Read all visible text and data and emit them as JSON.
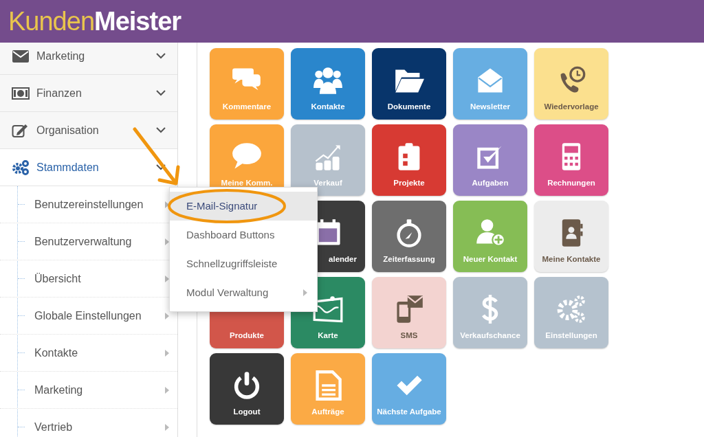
{
  "header": {
    "logo": "Kunden**Meister**"
  },
  "sidebar": {
    "items": [
      {
        "label": "Marketing",
        "kind": "envelope",
        "selected": false
      },
      {
        "label": "Finanzen",
        "kind": "money",
        "selected": false
      },
      {
        "label": "Organisation",
        "kind": "edit",
        "selected": false
      },
      {
        "label": "Stammdaten",
        "kind": "gears",
        "selected": true
      }
    ],
    "subitems": [
      {
        "label": "Benutzereinstellungen",
        "has_submenu": true
      },
      {
        "label": "Benutzerverwaltung",
        "has_submenu": true
      },
      {
        "label": "Übersicht",
        "has_submenu": true
      },
      {
        "label": "Globale Einstellungen",
        "has_submenu": true
      },
      {
        "label": "Kontakte",
        "has_submenu": true
      },
      {
        "label": "Marketing",
        "has_submenu": true
      },
      {
        "label": "Vertrieb",
        "has_submenu": true
      }
    ]
  },
  "submenu": {
    "items": [
      {
        "label": "E-Mail-Signatur",
        "selected": true,
        "has_submenu": false
      },
      {
        "label": "Dashboard Buttons",
        "selected": false,
        "has_submenu": false
      },
      {
        "label": "Schnellzugriffsleiste",
        "selected": false,
        "has_submenu": false
      },
      {
        "label": "Modul Verwaltung",
        "selected": false,
        "has_submenu": true
      }
    ]
  },
  "tiles": [
    {
      "kind": "comments",
      "label": "Kommentare",
      "color": "#fba63c"
    },
    {
      "kind": "people",
      "label": "Kontakte",
      "color": "#2a86cc"
    },
    {
      "kind": "folder",
      "label": "Dokumente",
      "color": "#08356b"
    },
    {
      "kind": "envelope",
      "label": "Newsletter",
      "color": "#67aee2"
    },
    {
      "kind": "phone-clock",
      "label": "Wiedervorlage",
      "color": "#fbe08e"
    },
    {
      "kind": "speech",
      "label": "Meine Komm.",
      "color": "#fba63c"
    },
    {
      "kind": "chart",
      "label": "Verkauf",
      "color": "#b6c1cc"
    },
    {
      "kind": "clipboard",
      "label": "Projekte",
      "color": "#d73a33"
    },
    {
      "kind": "checkbox",
      "label": "Aufgaben",
      "color": "#9a86c6"
    },
    {
      "kind": "calculator",
      "label": "Rechnungen",
      "color": "#dc4e88"
    },
    {
      "kind": "covered"
    },
    {
      "kind": "calendar",
      "label": "alender",
      "color": "#3c3c3c",
      "clipped_left": true
    },
    {
      "kind": "stopwatch",
      "label": "Zeiterfassung",
      "color": "#6e6e6e"
    },
    {
      "kind": "add-person",
      "label": "Neuer Kontakt",
      "color": "#86bd55"
    },
    {
      "kind": "address-book",
      "label": "Meine Kontakte",
      "color": "#ececec"
    },
    {
      "kind": "covered-top",
      "label": "Produkte",
      "color": "#d2564a"
    },
    {
      "kind": "map",
      "label": "Karte",
      "color": "#2b8a63"
    },
    {
      "kind": "sms",
      "label": "SMS",
      "color": "#f3d3d0"
    },
    {
      "kind": "dollar",
      "label": "Verkaufschance",
      "color": "#b5c2ce"
    },
    {
      "kind": "gears",
      "label": "Einstellungen",
      "color": "#b5c2ce"
    },
    {
      "kind": "power",
      "label": "Logout",
      "color": "#383838"
    },
    {
      "kind": "document",
      "label": "Aufträge",
      "color": "#fbaa45"
    },
    {
      "kind": "check",
      "label": "Nächste Aufgabe",
      "color": "#66ade2"
    }
  ]
}
